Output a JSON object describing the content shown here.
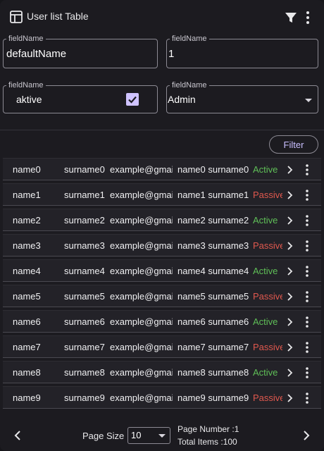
{
  "header": {
    "title": "User list Table",
    "icons": [
      "table-icon",
      "filter-icon",
      "more-vertical-icon"
    ]
  },
  "fields": {
    "name": {
      "legend": "fieldName",
      "value": "defaultName"
    },
    "number": {
      "legend": "fieldName",
      "value": "1"
    },
    "aktive": {
      "legend": "fieldName",
      "label": "aktive",
      "checked": true
    },
    "role": {
      "legend": "fieldName",
      "value": "Admin"
    }
  },
  "filter_button": "Filter",
  "rows": [
    {
      "name": "name0",
      "surname": "surname0",
      "email": "example@gmai",
      "full": "name0 surname0",
      "status": "Active"
    },
    {
      "name": "name1",
      "surname": "surname1",
      "email": "example@gmai",
      "full": "name1 surname1",
      "status": "Passive"
    },
    {
      "name": "name2",
      "surname": "surname2",
      "email": "example@gmai",
      "full": "name2 surname2",
      "status": "Active"
    },
    {
      "name": "name3",
      "surname": "surname3",
      "email": "example@gmai",
      "full": "name3 surname3",
      "status": "Passive"
    },
    {
      "name": "name4",
      "surname": "surname4",
      "email": "example@gmai",
      "full": "name4 surname4",
      "status": "Active"
    },
    {
      "name": "name5",
      "surname": "surname5",
      "email": "example@gmai",
      "full": "name5 surname5",
      "status": "Passive"
    },
    {
      "name": "name6",
      "surname": "surname6",
      "email": "example@gmai",
      "full": "name6 surname6",
      "status": "Active"
    },
    {
      "name": "name7",
      "surname": "surname7",
      "email": "example@gmai",
      "full": "name7 surname7",
      "status": "Passive"
    },
    {
      "name": "name8",
      "surname": "surname8",
      "email": "example@gmai",
      "full": "name8 surname8",
      "status": "Active"
    },
    {
      "name": "name9",
      "surname": "surname9",
      "email": "example@gmai",
      "full": "name9 surname9",
      "status": "Passive"
    }
  ],
  "footer": {
    "page_size_label": "Page Size",
    "page_size": "10",
    "page_number": "Page Number :1",
    "total_items": "Total Items :100"
  },
  "colors": {
    "active": "#5fbf57",
    "passive": "#e0584e",
    "accent": "#c9bfff"
  }
}
